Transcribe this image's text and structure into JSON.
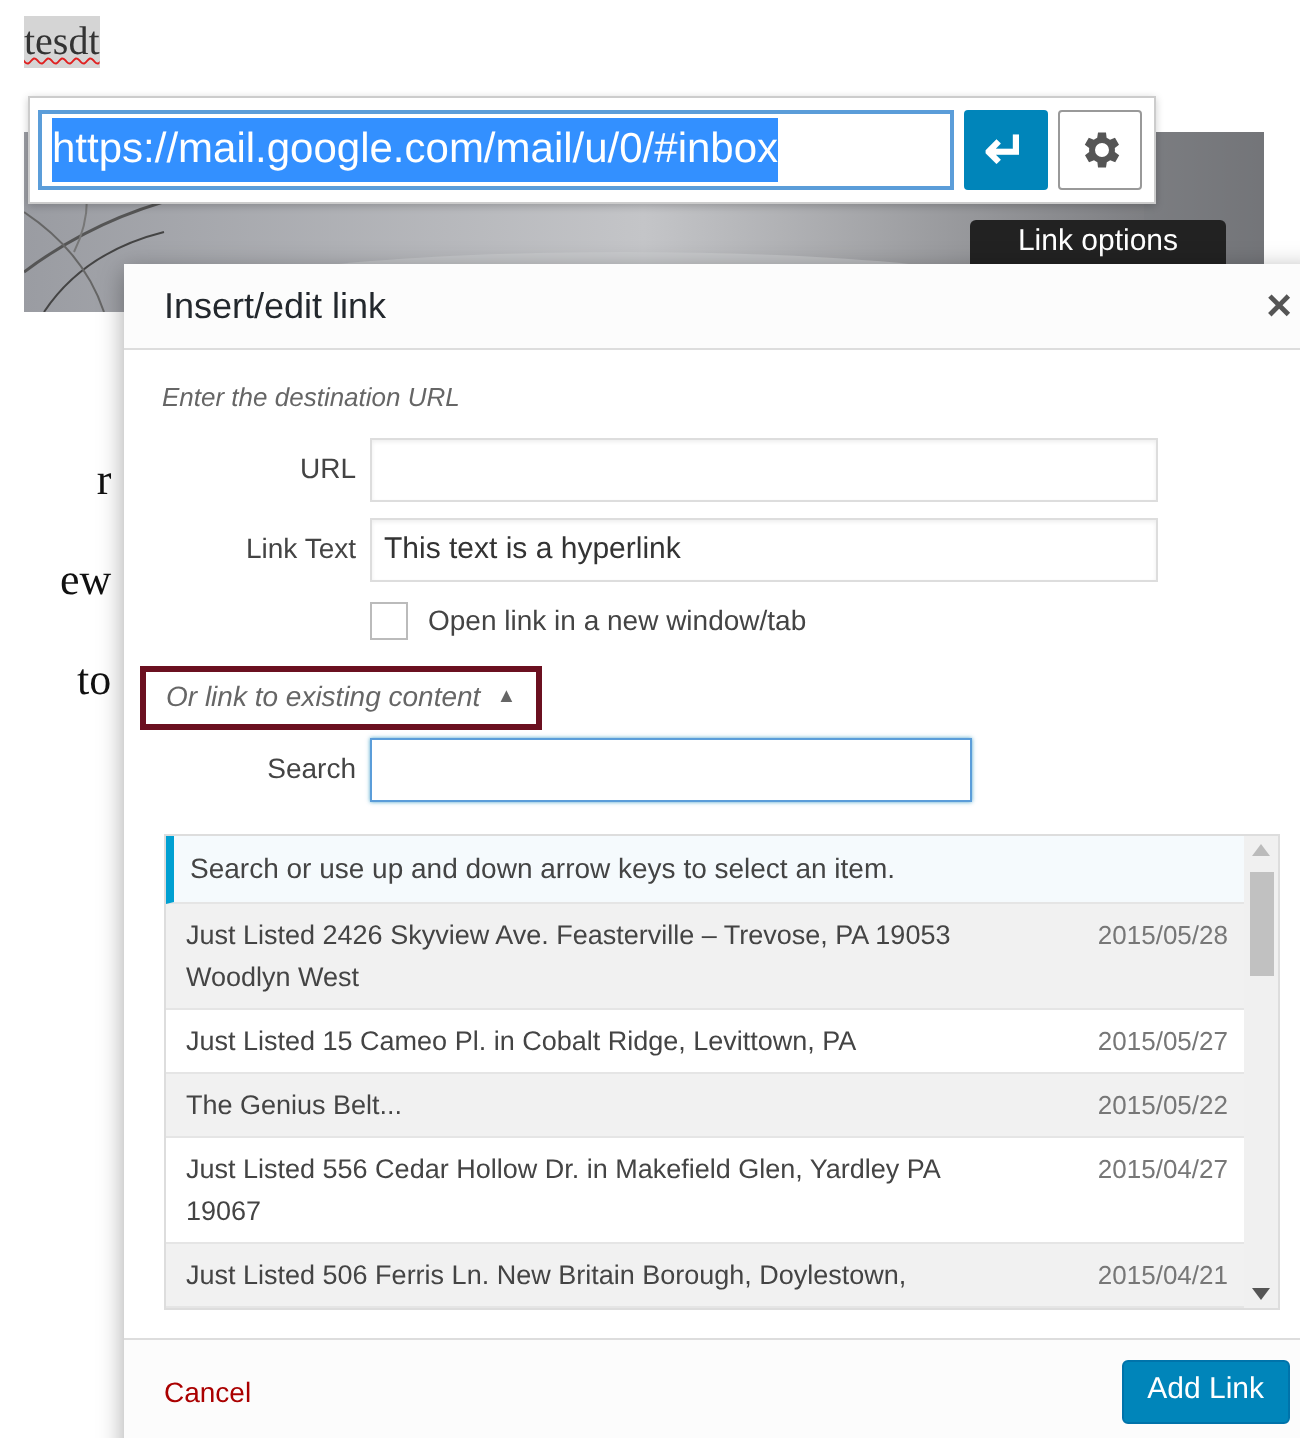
{
  "editor": {
    "word": "tesdt",
    "misspelled": true,
    "text_fragments": [
      "r",
      "ew",
      "to"
    ]
  },
  "link_popup": {
    "url": "https://mail.google.com/mail/u/0/#inbox",
    "url_selected": true,
    "apply_icon": "↵"
  },
  "tooltip": "Link options",
  "dialog": {
    "title": "Insert/edit link",
    "close": "×",
    "instruction": "Enter the destination URL",
    "fields": [
      {
        "label": "URL"
      },
      {
        "label": "Link Text",
        "value": "This text is a hyperlink"
      }
    ],
    "new_tab": {
      "label": "Open link in a new window/tab",
      "checked": false
    },
    "existing_toggle": {
      "label": "Or link to existing content",
      "arrow": "▲",
      "expanded": true
    },
    "search": {
      "label": "Search",
      "focused": true
    },
    "notice": "Search or use up and down arrow keys to select an item.",
    "results": [
      {
        "title": "Just Listed 2426 Skyview Ave. Feasterville – Trevose, PA 19053 Woodlyn West",
        "date": "2015/05/28"
      },
      {
        "title": "Just Listed 15 Cameo Pl. in Cobalt Ridge, Levittown, PA",
        "date": "2015/05/27"
      },
      {
        "title": "The Genius Belt...",
        "date": "2015/05/22"
      },
      {
        "title": "Just Listed 556 Cedar Hollow Dr. in Makefield Glen, Yardley PA 19067",
        "date": "2015/04/27"
      },
      {
        "title": "Just Listed 506 Ferris Ln. New Britain Borough, Doylestown,",
        "date": "2015/04/21"
      }
    ],
    "cancel": "Cancel",
    "submit": "Add Link"
  }
}
